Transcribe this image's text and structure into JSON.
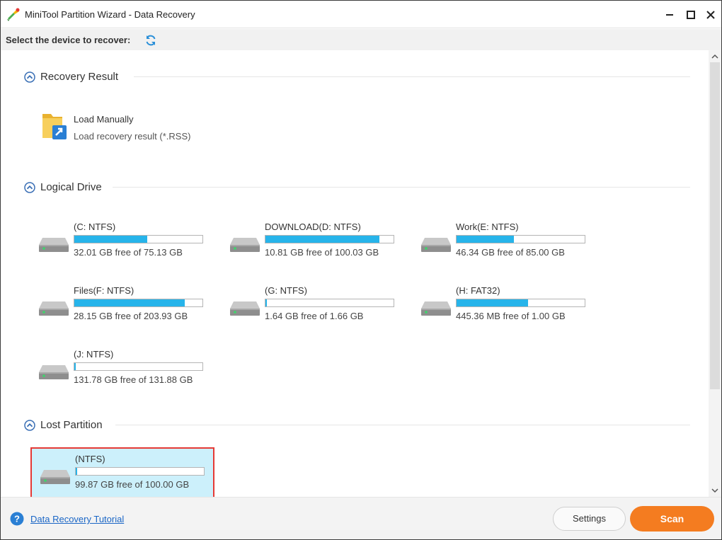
{
  "window": {
    "title": "MiniTool Partition Wizard - Data Recovery"
  },
  "subheader": {
    "label": "Select the device to recover:"
  },
  "sections": {
    "recovery_result": {
      "title": "Recovery Result",
      "load_title": "Load Manually",
      "load_sub": "Load recovery result (*.RSS)"
    },
    "logical_drive": {
      "title": "Logical Drive",
      "drives": [
        {
          "label": "(C: NTFS)",
          "free": "32.01 GB free of 75.13 GB",
          "used_fraction": 0.57
        },
        {
          "label": "DOWNLOAD(D: NTFS)",
          "free": "10.81 GB free of 100.03 GB",
          "used_fraction": 0.89
        },
        {
          "label": "Work(E: NTFS)",
          "free": "46.34 GB free of 85.00 GB",
          "used_fraction": 0.45
        },
        {
          "label": "Files(F: NTFS)",
          "free": "28.15 GB free of 203.93 GB",
          "used_fraction": 0.86
        },
        {
          "label": "(G: NTFS)",
          "free": "1.64 GB free of 1.66 GB",
          "used_fraction": 0.012
        },
        {
          "label": "(H: FAT32)",
          "free": "445.36 MB free of 1.00 GB",
          "used_fraction": 0.56
        },
        {
          "label": "(J: NTFS)",
          "free": "131.78 GB free of 131.88 GB",
          "used_fraction": 0.001
        }
      ]
    },
    "lost_partition": {
      "title": "Lost Partition",
      "drives": [
        {
          "label": "(NTFS)",
          "free": "99.87 GB free of 100.00 GB",
          "used_fraction": 0.001,
          "selected": true
        }
      ]
    }
  },
  "footer": {
    "tutorial_link": "Data Recovery Tutorial",
    "settings_label": "Settings",
    "scan_label": "Scan"
  },
  "colors": {
    "accent_orange": "#f47c20",
    "bar_fill": "#27b4ea",
    "selection_bg": "#ccf0fb",
    "selection_border": "#e53935",
    "link": "#1a66c6"
  },
  "icons": {
    "app": "minitool-app-icon",
    "refresh": "refresh-icon",
    "collapse": "chevron-up-circle-icon",
    "folder": "folder-load-icon",
    "drive": "hard-drive-icon",
    "help": "help-icon"
  }
}
